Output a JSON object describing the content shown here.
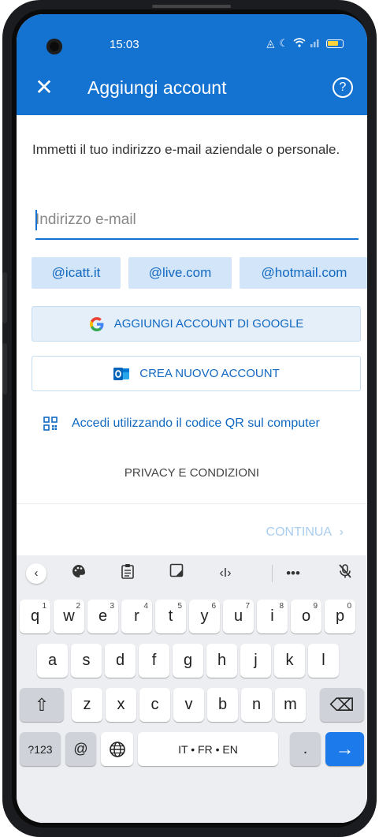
{
  "status_bar": {
    "time": "15:03"
  },
  "header": {
    "title": "Aggiungi account",
    "close_icon": "close-icon",
    "help_icon": "help-icon",
    "help_glyph": "?",
    "close_glyph": "✕"
  },
  "instruction": "Immetti il tuo indirizzo e-mail aziendale o personale.",
  "email": {
    "placeholder": "Indirizzo e-mail",
    "value": ""
  },
  "domains": [
    "@icatt.it",
    "@live.com",
    "@hotmail.com"
  ],
  "google_button": {
    "label": "AGGIUNGI ACCOUNT DI GOOGLE"
  },
  "create_button": {
    "label": "CREA NUOVO ACCOUNT"
  },
  "qr_link": {
    "label": "Accedi utilizzando il codice QR sul computer"
  },
  "privacy_link": {
    "label": "PRIVACY E CONDIZIONI"
  },
  "continue_button": {
    "label": "CONTINUA",
    "chevron": "›"
  },
  "keyboard": {
    "toolbar": [
      "back-chevron-icon",
      "palette-icon",
      "clipboard-icon",
      "resize-icon",
      "cursor-icon",
      "more-icon",
      "mic-off-icon"
    ],
    "row1": [
      {
        "k": "q",
        "s": "1"
      },
      {
        "k": "w",
        "s": "2"
      },
      {
        "k": "e",
        "s": "3"
      },
      {
        "k": "r",
        "s": "4"
      },
      {
        "k": "t",
        "s": "5"
      },
      {
        "k": "y",
        "s": "6"
      },
      {
        "k": "u",
        "s": "7"
      },
      {
        "k": "i",
        "s": "8"
      },
      {
        "k": "o",
        "s": "9"
      },
      {
        "k": "p",
        "s": "0"
      }
    ],
    "row2": [
      "a",
      "s",
      "d",
      "f",
      "g",
      "h",
      "j",
      "k",
      "l"
    ],
    "row3": [
      "z",
      "x",
      "c",
      "v",
      "b",
      "n",
      "m"
    ],
    "symbols_key": "?123",
    "at_key": "@",
    "dot_key": ".",
    "space_label": "IT • FR • EN",
    "enter_glyph": "→",
    "shift_glyph": "⇧",
    "backspace_glyph": "⌫"
  },
  "colors": {
    "accent": "#1472d1",
    "chip": "#d3e5f8",
    "keyboard_bg": "#eceef1",
    "enter": "#1c7aeb"
  }
}
